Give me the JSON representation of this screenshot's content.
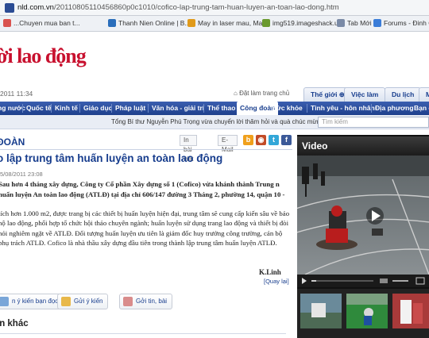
{
  "browser": {
    "url_host": "nld.com.vn",
    "url_path": "/20110805110456860p0c1010/cofico-lap-trung-tam-huan-luyen-an-toan-lao-dong.htm",
    "bookmarks": [
      {
        "label": "...Chuyen mua ban t...",
        "color": "#d9534f"
      },
      {
        "label": "Thanh Nien Online | B...",
        "color": "#2a6ebb"
      },
      {
        "label": "May in laser mau, Ma...",
        "color": "#e09a1a"
      },
      {
        "label": "img519.imageshack.u...",
        "color": "#6a9a2e"
      },
      {
        "label": "Tab Mới",
        "color": "#7a8aa6"
      },
      {
        "label": "Forums - Đinh Quy",
        "color": "#3b7dd8"
      }
    ]
  },
  "site": {
    "logo": "ời lao động",
    "datetime": "2011 11:34",
    "homepage_link": "Đặt làm trang chủ",
    "top_tabs": [
      "Thế giới ⊕",
      "Việc làm",
      "Du lịch",
      "Mu"
    ],
    "nav": [
      "ng nước",
      "Quốc tế",
      "Kinh tế",
      "Giáo dục",
      "Pháp luật",
      "Văn hóa - giải trí",
      "Thể thao",
      "Công đoàn",
      "Sức khỏe",
      "Tình yêu - hôn nhân",
      "Địa phương",
      "Bạn đ"
    ],
    "active_nav": "Công đoàn",
    "ticker": "Tổng Bí thư Nguyễn Phú Trọng vừa chuyển lời thăm hỏi và quà chúc mừng nguyên C",
    "search_placeholder": "Tìm kiếm"
  },
  "article": {
    "section": "ĐOÀN",
    "tools": {
      "print": "In bài viết",
      "email": "E-Mail"
    },
    "share_icons": [
      {
        "name": "yahoo-share-icon",
        "glyph": "b",
        "color": "#f0a01c"
      },
      {
        "name": "digg-share-icon",
        "glyph": "◉",
        "color": "#c24b27"
      },
      {
        "name": "twitter-share-icon",
        "glyph": "t",
        "color": "#33a7d8"
      },
      {
        "name": "facebook-share-icon",
        "glyph": "f",
        "color": "#3b5998"
      }
    ],
    "title": "o lập trung tâm huấn luyện an toàn lao động",
    "date": "5/08/2011 23:08",
    "lead": "Sau hơn 4 tháng xây dựng, Công ty Cổ phần Xây dựng số 1 (Cofico) vừa khánh thành Trung n huấn luyện An toàn lao động (ATLĐ) tại địa chỉ 606/147 đường 3 Tháng 2, phường 14, quận 10 -",
    "body": "tích hơn 1.000 m2, được trang bị các thiết bị huấn luyện hiện đại, trung tâm sẽ cung cấp kiến sâu về bảo hộ lao động, phối hợp tổ chức hội thảo chuyên ngành; huấn luyện sử dụng trang lao động và thiết bị đòi hỏi nghiêm ngặt về ATLĐ. Đối tượng huấn luyện ưu tiên là giám đốc huy trưởng công trường, cán bộ phụ trách ATLĐ. Cofico là nhà thầu xây dựng đầu tiên trong thành lập trung tâm huấn luyện ATLĐ.",
    "author": "K.Linh",
    "back": "[Quay lại]",
    "actions": {
      "comments": "n ý kiến bạn đọc",
      "send_comment": "Gửi ý kiến",
      "send_article": "Gởi tin, bài"
    },
    "more_heading": "in khác"
  },
  "video": {
    "heading": "Video"
  },
  "colors": {
    "brand_red": "#c8102e",
    "nav_blue": "#1e3f8c",
    "link_blue": "#173d8d"
  }
}
